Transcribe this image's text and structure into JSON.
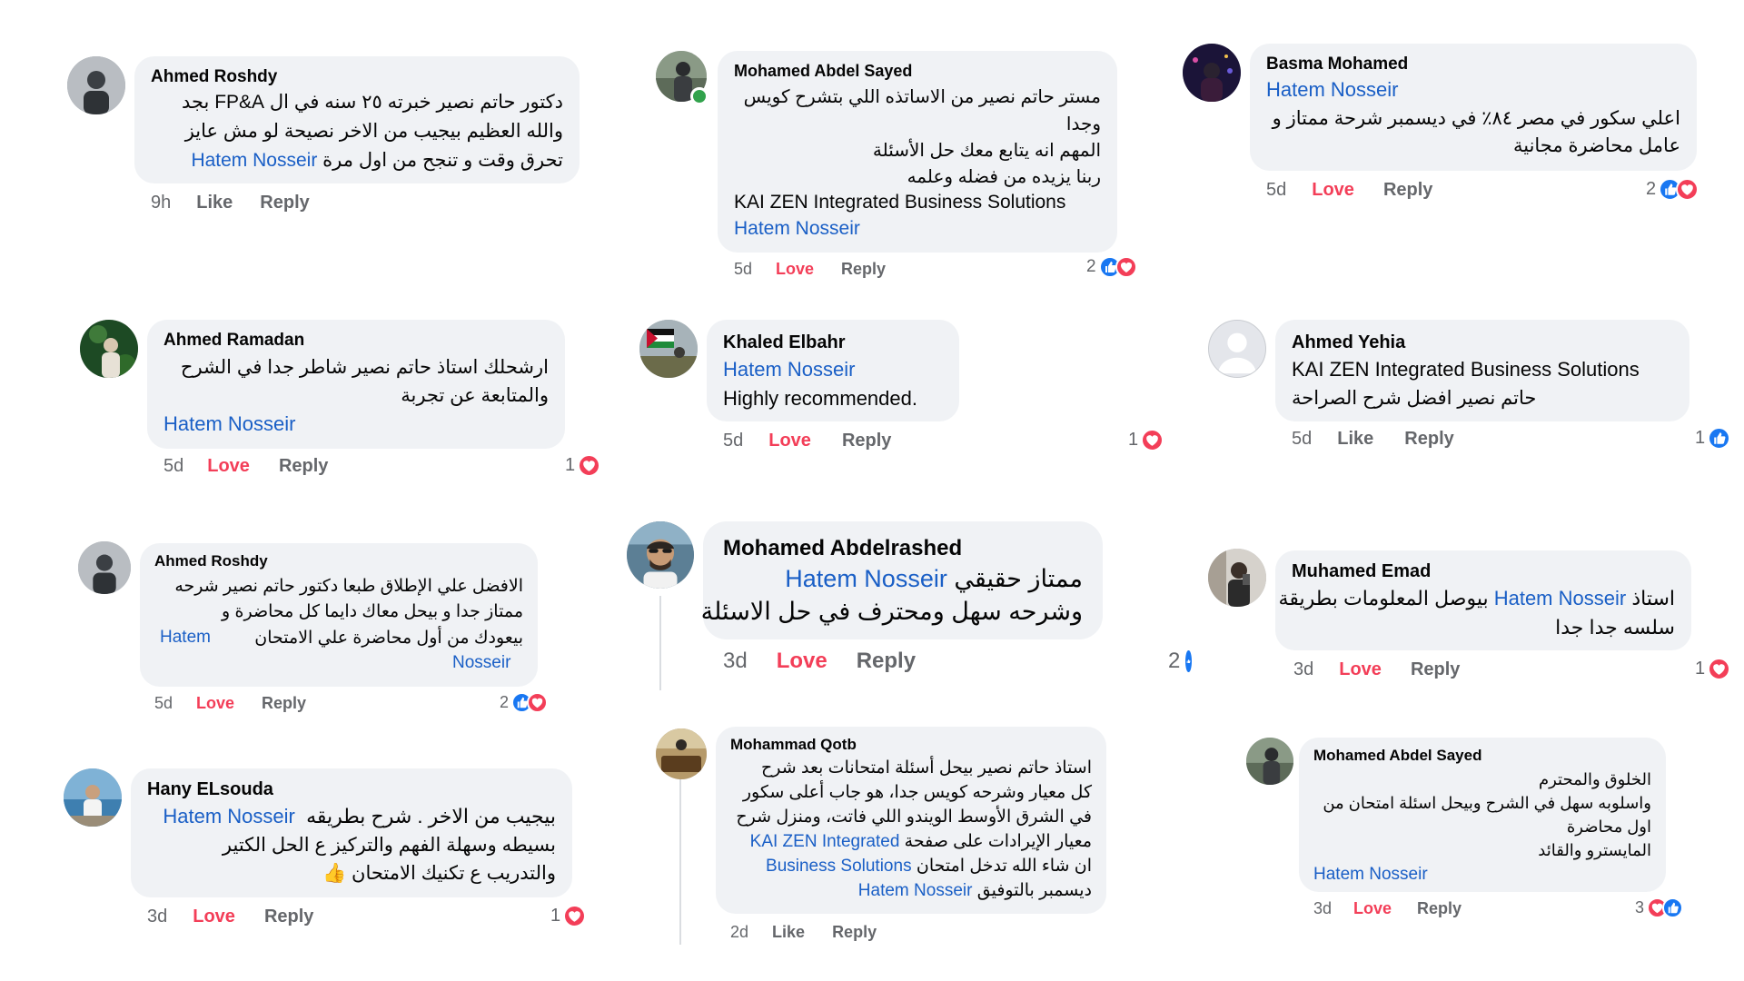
{
  "reaction_icons": {
    "like_color": "#1877f2",
    "love_color": "#f33e58",
    "like_icon": "thumbs-up-icon",
    "love_icon": "heart-icon"
  },
  "comments": [
    {
      "name": "Ahmed Roshdy",
      "lines": [
        "دكتور حاتم نصير خبرته ٢٥ سنه في ال FP&A  بجد",
        "والله العظيم بيجيب من الاخر نصيحة لو مش عايز",
        "تحرق وقت و تنجح من اول مرة"
      ],
      "mention": "Hatem Nosseir",
      "time": "9h",
      "action1": "Like",
      "reply": "Reply"
    },
    {
      "name": "Mohamed Abdel Sayed",
      "lines": [
        "مستر حاتم نصير من الاساتذه اللي بتشرح كويس",
        "وجدا",
        "المهم انه يتابع معك حل الأسئلة",
        "ربنا يزيده من فضله وعلمه",
        "KAI ZEN Integrated Business Solutions"
      ],
      "mention": "Hatem Nosseir",
      "time": "5d",
      "action1": "Love",
      "reply": "Reply",
      "count": "2"
    },
    {
      "name": "Basma Mohamed",
      "mention": "Hatem Nosseir",
      "lines": [
        "اعلي سكور في مصر ٨٤٪ في ديسمبر شرحة ممتاز و",
        "عامل محاضرة مجانية"
      ],
      "time": "5d",
      "action1": "Love",
      "reply": "Reply",
      "count": "2"
    },
    {
      "name": "Ahmed Ramadan",
      "lines": [
        "ارشحلك استاذ حاتم نصير شاطر جدا في الشرح",
        "والمتابعة عن تجربة"
      ],
      "mention": "Hatem Nosseir",
      "time": "5d",
      "action1": "Love",
      "reply": "Reply",
      "count": "1"
    },
    {
      "name": "Khaled Elbahr",
      "mention": "Hatem Nosseir",
      "lines": [
        "Highly recommended."
      ],
      "time": "5d",
      "action1": "Love",
      "reply": "Reply",
      "count": "1"
    },
    {
      "name": "Ahmed Yehia",
      "lines": [
        "KAI ZEN Integrated Business Solutions",
        "حاتم نصير افضل شرح الصراحة"
      ],
      "time": "5d",
      "action1": "Like",
      "reply": "Reply",
      "count": "1"
    },
    {
      "name": "Ahmed Roshdy",
      "lines": [
        "الافضل علي الإطلاق طبعا دكتور حاتم نصير شرحه",
        "ممتاز جدا و بيحل معاك دايما كل محاضرة و",
        "بيعودك من أول محاضرة علي الامتحان"
      ],
      "mention_a": "Hatem",
      "mention_b": "Nosseir",
      "time": "5d",
      "action1": "Love",
      "reply": "Reply",
      "count": "2"
    },
    {
      "name": "Mohamed Abdelrashed",
      "mention": "Hatem Nosseir",
      "line1_rest": "ممتاز حقيقي",
      "lines": [
        "وشرحه سهل ومحترف في حل الاسئلة"
      ],
      "time": "3d",
      "action1": "Love",
      "reply": "Reply",
      "count": "2"
    },
    {
      "name": "Muhamed Emad",
      "line1_pre": "استاذ",
      "mention": "Hatem Nosseir",
      "line1_post": "بيوصل المعلومات بطريقة",
      "lines": [
        "سلسه جدا جدا"
      ],
      "time": "3d",
      "action1": "Love",
      "reply": "Reply",
      "count": "1"
    },
    {
      "name": "Hany ELsouda",
      "mention": "Hatem Nosseir",
      "line1_rest": "بيجيب من الاخر . شرح بطريقه",
      "lines": [
        "بسيطه وسهلة الفهم والتركيز ع الحل الكتير",
        "والتدريب ع تكنيك الامتحان 👍"
      ],
      "time": "3d",
      "action1": "Love",
      "reply": "Reply",
      "count": "1"
    },
    {
      "name": "Mohammad Qotb",
      "lines": [
        "استاذ حاتم نصير بيحل أسئلة امتحانات بعد شرح",
        "كل معيار وشرحه كويس جدا، هو جاب أعلى سكور",
        "في الشرق الأوسط الويندو اللي فاتت، ومنزل شرح"
      ],
      "line4_pre": "معيار الإيرادات على صفحة",
      "mention_a": "KAI ZEN Integrated",
      "line5_pre": "ان شاء الله تدخل امتحان",
      "mention_b": "Business Solutions",
      "mention": "Hatem Nosseir",
      "line6_post": "ديسمبر بالتوفيق",
      "time": "2d",
      "action1": "Like",
      "reply": "Reply"
    },
    {
      "name": "Mohamed Abdel Sayed",
      "lines": [
        "الخلوق والمحترم",
        "واسلوبه سهل في الشرح وبيحل اسئلة امتحان من",
        "اول محاضرة",
        "المايسترو والقائد"
      ],
      "mention": "Hatem Nosseir",
      "time": "3d",
      "action1": "Love",
      "reply": "Reply",
      "count": "3"
    }
  ]
}
